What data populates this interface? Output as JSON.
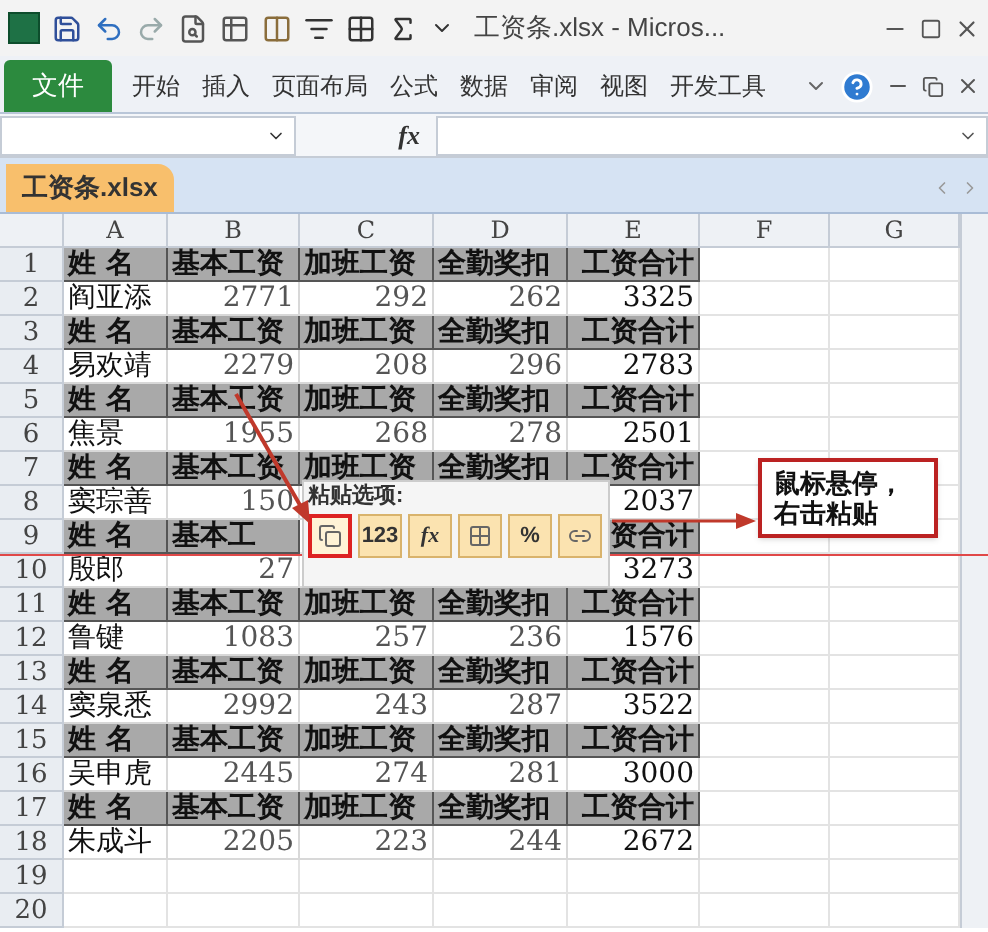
{
  "title_bar": {
    "title": "工资条.xlsx - Micros..."
  },
  "ribbon": {
    "file_tab": "文件",
    "tabs": [
      {
        "label": "开始",
        "selected": false
      },
      {
        "label": "插入",
        "selected": false
      },
      {
        "label": "页面布局",
        "selected": false
      },
      {
        "label": "公式",
        "selected": false
      },
      {
        "label": "数据",
        "selected": false
      },
      {
        "label": "审阅",
        "selected": false
      },
      {
        "label": "视图",
        "selected": false
      },
      {
        "label": "开发工具",
        "selected": false
      }
    ]
  },
  "formula_bar": {
    "fx": "fx"
  },
  "workbook_tab": {
    "label": "工资条.xlsx",
    "selected": true
  },
  "columns": [
    "A",
    "B",
    "C",
    "D",
    "E",
    "F",
    "G"
  ],
  "rows": [
    {
      "number": "1",
      "kind": "header",
      "cells": [
        "姓 名",
        "基本工资",
        "加班工资",
        "全勤奖扣",
        "工资合计"
      ]
    },
    {
      "number": "2",
      "kind": "data",
      "cells": [
        "阎亚添",
        "2771",
        "292",
        "262",
        "3325"
      ]
    },
    {
      "number": "3",
      "kind": "header",
      "cells": [
        "姓 名",
        "基本工资",
        "加班工资",
        "全勤奖扣",
        "工资合计"
      ]
    },
    {
      "number": "4",
      "kind": "data",
      "cells": [
        "易欢靖",
        "2279",
        "208",
        "296",
        "2783"
      ]
    },
    {
      "number": "5",
      "kind": "header",
      "cells": [
        "姓 名",
        "基本工资",
        "加班工资",
        "全勤奖扣",
        "工资合计"
      ]
    },
    {
      "number": "6",
      "kind": "data",
      "cells": [
        "焦景",
        "1955",
        "268",
        "278",
        "2501"
      ]
    },
    {
      "number": "7",
      "kind": "header",
      "cells": [
        "姓 名",
        "基本工资",
        "加班工资",
        "全勤奖扣",
        "工资合计"
      ]
    },
    {
      "number": "8",
      "kind": "data",
      "cells": [
        "窦琮善",
        "150",
        null,
        null,
        "2037"
      ]
    },
    {
      "number": "9",
      "kind": "header",
      "cells": [
        "姓 名",
        "基本工",
        null,
        null,
        "资合计"
      ]
    },
    {
      "number": "10",
      "kind": "data",
      "cells": [
        "殷郎",
        "27",
        null,
        null,
        "3273"
      ]
    },
    {
      "number": "11",
      "kind": "header",
      "cells": [
        "姓 名",
        "基本工资",
        "加班工资",
        "全勤奖扣",
        "工资合计"
      ]
    },
    {
      "number": "12",
      "kind": "data",
      "cells": [
        "鲁键",
        "1083",
        "257",
        "236",
        "1576"
      ]
    },
    {
      "number": "13",
      "kind": "header",
      "cells": [
        "姓 名",
        "基本工资",
        "加班工资",
        "全勤奖扣",
        "工资合计"
      ]
    },
    {
      "number": "14",
      "kind": "data",
      "cells": [
        "窦泉悉",
        "2992",
        "243",
        "287",
        "3522"
      ]
    },
    {
      "number": "15",
      "kind": "header",
      "cells": [
        "姓 名",
        "基本工资",
        "加班工资",
        "全勤奖扣",
        "工资合计"
      ]
    },
    {
      "number": "16",
      "kind": "data",
      "cells": [
        "吴申虎",
        "2445",
        "274",
        "281",
        "3000"
      ]
    },
    {
      "number": "17",
      "kind": "header",
      "cells": [
        "姓 名",
        "基本工资",
        "加班工资",
        "全勤奖扣",
        "工资合计"
      ]
    },
    {
      "number": "18",
      "kind": "data",
      "cells": [
        "朱成斗",
        "2205",
        "223",
        "244",
        "2672"
      ]
    },
    {
      "number": "19",
      "kind": "empty"
    },
    {
      "number": "20",
      "kind": "empty"
    }
  ],
  "paste_options": {
    "label": "粘贴选项:",
    "options": [
      {
        "kind": "paste",
        "selected": true
      },
      {
        "kind": "values",
        "text": "123",
        "selected": false
      },
      {
        "kind": "formulas",
        "text": "fx",
        "selected": false
      },
      {
        "kind": "transpose",
        "selected": false
      },
      {
        "kind": "formatting",
        "text": "%",
        "selected": false
      },
      {
        "kind": "link",
        "selected": false
      }
    ]
  },
  "callout": {
    "lines": [
      "鼠标悬停，",
      "右击粘贴"
    ]
  }
}
